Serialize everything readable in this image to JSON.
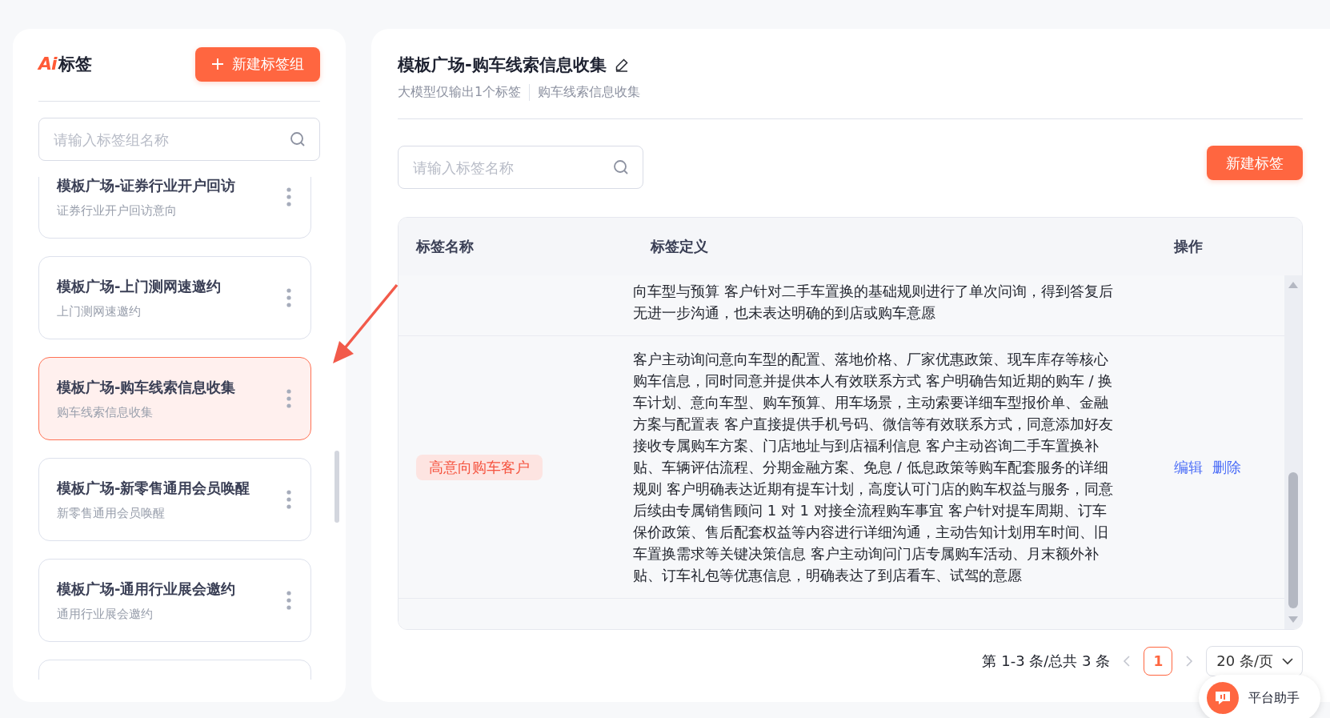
{
  "sidebar": {
    "logo_mark": "Ai",
    "title": "标签",
    "new_group_button": "新建标签组",
    "search": {
      "placeholder": "请输入标签组名称"
    },
    "groups": [
      {
        "kind": "card",
        "name": "模板广场-证券行业开户回访",
        "description": "证券行业开户回访意向",
        "selected": false
      },
      {
        "kind": "card",
        "name": "模板广场-上门测网速邀约",
        "description": "上门测网速邀约",
        "selected": false
      },
      {
        "kind": "card",
        "name": "模板广场-购车线索信息收集",
        "description": "购车线索信息收集",
        "selected": true
      },
      {
        "kind": "card",
        "name": "模板广场-新零售通用会员唤醒",
        "description": "新零售通用会员唤醒",
        "selected": false
      },
      {
        "kind": "card",
        "name": "模板广场-通用行业展会邀约",
        "description": "通用行业展会邀约",
        "selected": false
      },
      {
        "kind": "clipped",
        "selected": false
      }
    ]
  },
  "main": {
    "title": "模板广场-购车线索信息收集",
    "meta": [
      "大模型仅输出1个标签",
      "购车线索信息收集"
    ],
    "search": {
      "placeholder": "请输入标签名称"
    },
    "new_tag_button": "新建标签",
    "table": {
      "columns": [
        "标签名称",
        "标签定义",
        "操作"
      ],
      "rows": [
        {
          "definition": "向车型与预算 客户针对二手车置换的基础规则进行了单次问询，得到答复后无进一步沟通，也未表达明确的到店或购车意愿"
        },
        {
          "name": "高意向购车客户",
          "definition": "客户主动询问意向车型的配置、落地价格、厂家优惠政策、现车库存等核心购车信息，同时同意并提供本人有效联系方式 客户明确告知近期的购车 / 换车计划、意向车型、购车预算、用车场景，主动索要详细车型报价单、金融方案与配置表 客户直接提供手机号码、微信等有效联系方式，同意添加好友接收专属购车方案、门店地址与到店福利信息 客户主动咨询二手车置换补贴、车辆评估流程、分期金融方案、免息 / 低息政策等购车配套服务的详细规则 客户明确表达近期有提车计划，高度认可门店的购车权益与服务，同意后续由专属销售顾问 1 对 1 对接全流程购车事宜 客户针对提车周期、订车保价政策、售后配套权益等内容进行详细沟通，主动告知计划用车时间、旧车置换需求等关键决策信息 客户主动询问门店专属购车活动、月末额外补贴、订车礼包等优惠信息，明确表达了到店看车、试驾的意愿",
          "actions": [
            "编辑",
            "删除"
          ]
        }
      ]
    },
    "pagination": {
      "summary": "第 1-3 条/总共 3 条",
      "pages": [
        {
          "label": "1",
          "selected": true
        }
      ],
      "page_size": "20 条/页"
    }
  },
  "assistant": {
    "label": "平台助手"
  }
}
